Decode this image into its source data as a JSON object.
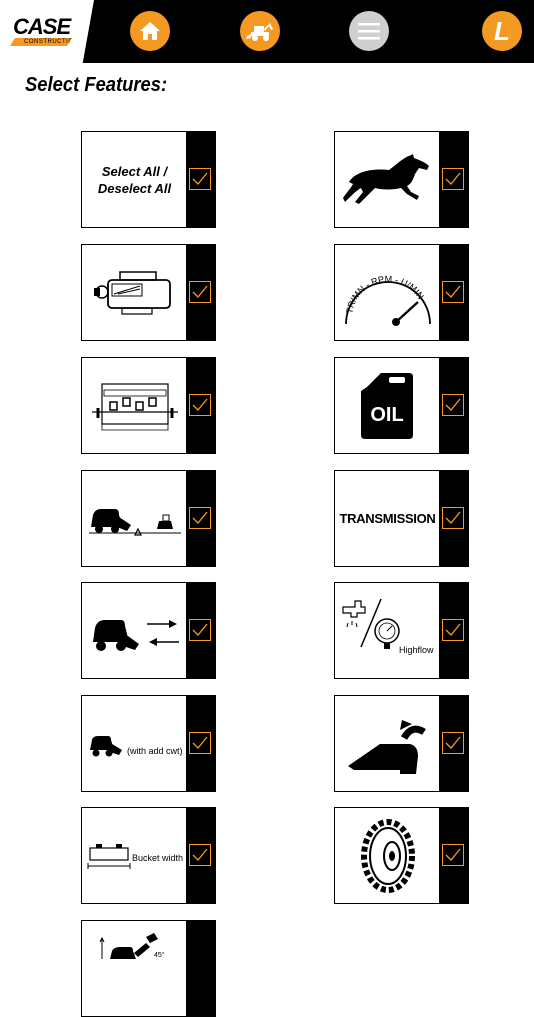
{
  "header": {
    "logo": {
      "brand": "CASE",
      "sub": "CONSTRUCTION"
    },
    "nav": [
      {
        "id": "home",
        "icon": "home-icon"
      },
      {
        "id": "machines",
        "icon": "backhoe-icon"
      },
      {
        "id": "menu",
        "icon": "hamburger-menu-icon"
      },
      {
        "id": "user",
        "icon": "user-letter-icon",
        "letter": "L"
      }
    ],
    "colors": {
      "accent": "#f49a22",
      "bar": "#000000",
      "menu_inactive": "#cfcfcf"
    }
  },
  "page": {
    "title": "Select Features:"
  },
  "features": [
    {
      "id": "select-all",
      "label": "Select All / Deselect All",
      "checked": true
    },
    {
      "id": "horsepower",
      "icon": "horse-icon",
      "checked": true
    },
    {
      "id": "engine",
      "icon": "engine-icon",
      "checked": true
    },
    {
      "id": "rpm",
      "icon": "rpm-gauge-icon",
      "text": "TR/MN - RPM - U/MIN",
      "checked": true
    },
    {
      "id": "hydraulics",
      "icon": "hydraulic-valves-icon",
      "checked": true
    },
    {
      "id": "oil",
      "icon": "oil-can-icon",
      "text": "OIL",
      "checked": true
    },
    {
      "id": "tipping-load",
      "icon": "tipping-load-icon",
      "checked": true
    },
    {
      "id": "transmission",
      "label": "TRANSMISSION",
      "checked": true
    },
    {
      "id": "travel-speed",
      "icon": "travel-speed-icon",
      "checked": true
    },
    {
      "id": "highflow",
      "icon": "highflow-icon",
      "label": "Highflow",
      "checked": true
    },
    {
      "id": "counterweight",
      "icon": "loader-counterweight-icon",
      "label": "(with add cwt)",
      "checked": true
    },
    {
      "id": "bucket-rollback",
      "icon": "bucket-rollback-icon",
      "checked": true
    },
    {
      "id": "bucket-width",
      "icon": "bucket-width-icon",
      "label": "Bucket width",
      "checked": true
    },
    {
      "id": "tires",
      "icon": "tire-icon",
      "checked": true
    },
    {
      "id": "dump-height",
      "icon": "dump-height-icon",
      "checked": true
    }
  ]
}
